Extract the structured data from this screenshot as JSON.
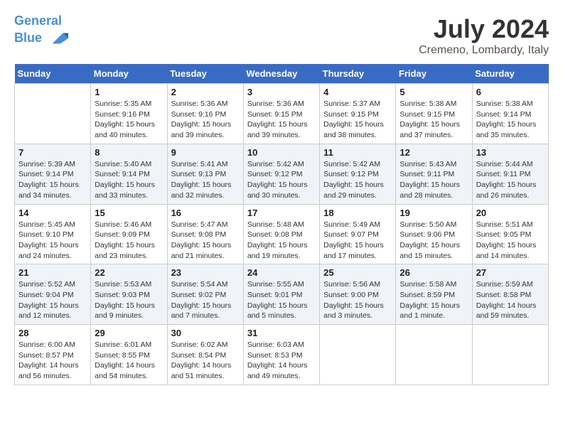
{
  "header": {
    "logo_line1": "General",
    "logo_line2": "Blue",
    "month_year": "July 2024",
    "location": "Cremeno, Lombardy, Italy"
  },
  "weekdays": [
    "Sunday",
    "Monday",
    "Tuesday",
    "Wednesday",
    "Thursday",
    "Friday",
    "Saturday"
  ],
  "weeks": [
    [
      {
        "day": "",
        "info": ""
      },
      {
        "day": "1",
        "info": "Sunrise: 5:35 AM\nSunset: 9:16 PM\nDaylight: 15 hours\nand 40 minutes."
      },
      {
        "day": "2",
        "info": "Sunrise: 5:36 AM\nSunset: 9:16 PM\nDaylight: 15 hours\nand 39 minutes."
      },
      {
        "day": "3",
        "info": "Sunrise: 5:36 AM\nSunset: 9:15 PM\nDaylight: 15 hours\nand 39 minutes."
      },
      {
        "day": "4",
        "info": "Sunrise: 5:37 AM\nSunset: 9:15 PM\nDaylight: 15 hours\nand 38 minutes."
      },
      {
        "day": "5",
        "info": "Sunrise: 5:38 AM\nSunset: 9:15 PM\nDaylight: 15 hours\nand 37 minutes."
      },
      {
        "day": "6",
        "info": "Sunrise: 5:38 AM\nSunset: 9:14 PM\nDaylight: 15 hours\nand 35 minutes."
      }
    ],
    [
      {
        "day": "7",
        "info": "Sunrise: 5:39 AM\nSunset: 9:14 PM\nDaylight: 15 hours\nand 34 minutes."
      },
      {
        "day": "8",
        "info": "Sunrise: 5:40 AM\nSunset: 9:14 PM\nDaylight: 15 hours\nand 33 minutes."
      },
      {
        "day": "9",
        "info": "Sunrise: 5:41 AM\nSunset: 9:13 PM\nDaylight: 15 hours\nand 32 minutes."
      },
      {
        "day": "10",
        "info": "Sunrise: 5:42 AM\nSunset: 9:12 PM\nDaylight: 15 hours\nand 30 minutes."
      },
      {
        "day": "11",
        "info": "Sunrise: 5:42 AM\nSunset: 9:12 PM\nDaylight: 15 hours\nand 29 minutes."
      },
      {
        "day": "12",
        "info": "Sunrise: 5:43 AM\nSunset: 9:11 PM\nDaylight: 15 hours\nand 28 minutes."
      },
      {
        "day": "13",
        "info": "Sunrise: 5:44 AM\nSunset: 9:11 PM\nDaylight: 15 hours\nand 26 minutes."
      }
    ],
    [
      {
        "day": "14",
        "info": "Sunrise: 5:45 AM\nSunset: 9:10 PM\nDaylight: 15 hours\nand 24 minutes."
      },
      {
        "day": "15",
        "info": "Sunrise: 5:46 AM\nSunset: 9:09 PM\nDaylight: 15 hours\nand 23 minutes."
      },
      {
        "day": "16",
        "info": "Sunrise: 5:47 AM\nSunset: 9:08 PM\nDaylight: 15 hours\nand 21 minutes."
      },
      {
        "day": "17",
        "info": "Sunrise: 5:48 AM\nSunset: 9:08 PM\nDaylight: 15 hours\nand 19 minutes."
      },
      {
        "day": "18",
        "info": "Sunrise: 5:49 AM\nSunset: 9:07 PM\nDaylight: 15 hours\nand 17 minutes."
      },
      {
        "day": "19",
        "info": "Sunrise: 5:50 AM\nSunset: 9:06 PM\nDaylight: 15 hours\nand 15 minutes."
      },
      {
        "day": "20",
        "info": "Sunrise: 5:51 AM\nSunset: 9:05 PM\nDaylight: 15 hours\nand 14 minutes."
      }
    ],
    [
      {
        "day": "21",
        "info": "Sunrise: 5:52 AM\nSunset: 9:04 PM\nDaylight: 15 hours\nand 12 minutes."
      },
      {
        "day": "22",
        "info": "Sunrise: 5:53 AM\nSunset: 9:03 PM\nDaylight: 15 hours\nand 9 minutes."
      },
      {
        "day": "23",
        "info": "Sunrise: 5:54 AM\nSunset: 9:02 PM\nDaylight: 15 hours\nand 7 minutes."
      },
      {
        "day": "24",
        "info": "Sunrise: 5:55 AM\nSunset: 9:01 PM\nDaylight: 15 hours\nand 5 minutes."
      },
      {
        "day": "25",
        "info": "Sunrise: 5:56 AM\nSunset: 9:00 PM\nDaylight: 15 hours\nand 3 minutes."
      },
      {
        "day": "26",
        "info": "Sunrise: 5:58 AM\nSunset: 8:59 PM\nDaylight: 15 hours\nand 1 minute."
      },
      {
        "day": "27",
        "info": "Sunrise: 5:59 AM\nSunset: 8:58 PM\nDaylight: 14 hours\nand 59 minutes."
      }
    ],
    [
      {
        "day": "28",
        "info": "Sunrise: 6:00 AM\nSunset: 8:57 PM\nDaylight: 14 hours\nand 56 minutes."
      },
      {
        "day": "29",
        "info": "Sunrise: 6:01 AM\nSunset: 8:55 PM\nDaylight: 14 hours\nand 54 minutes."
      },
      {
        "day": "30",
        "info": "Sunrise: 6:02 AM\nSunset: 8:54 PM\nDaylight: 14 hours\nand 51 minutes."
      },
      {
        "day": "31",
        "info": "Sunrise: 6:03 AM\nSunset: 8:53 PM\nDaylight: 14 hours\nand 49 minutes."
      },
      {
        "day": "",
        "info": ""
      },
      {
        "day": "",
        "info": ""
      },
      {
        "day": "",
        "info": ""
      }
    ]
  ]
}
